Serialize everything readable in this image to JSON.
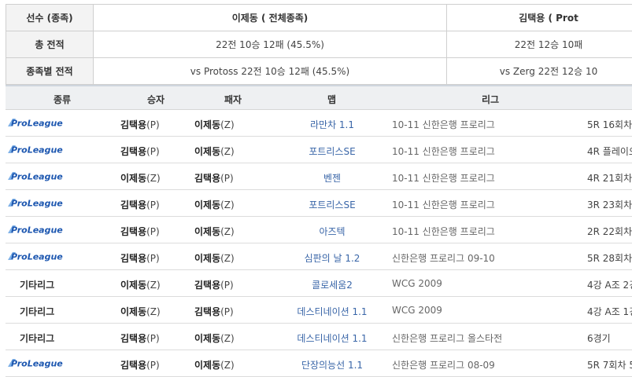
{
  "summary": {
    "header": {
      "label": "선수 (종족)",
      "p1": "이제동 ( 전체종족)",
      "p2": "김택용 ( Prot"
    },
    "total": {
      "label": "총 전적",
      "p1": "22전 10승 12패 (45.5%)",
      "p2": "22전 12승 10패"
    },
    "by_race": {
      "label": "종족별 전적",
      "p1": "vs Protoss 22전 10승 12패 (45.5%)",
      "p2": "vs Zerg 22전 12승 10"
    }
  },
  "columns": {
    "type": "종류",
    "winner": "승자",
    "loser": "패자",
    "map": "맵",
    "league": "리그"
  },
  "proleague_logo_text": "ProLeague",
  "colors": {
    "logo_blue": "#1d57b0",
    "map_link": "#3a66a8",
    "header_bg": "#eef0f2"
  },
  "matches": [
    {
      "type": "proleague",
      "winner": "김택용",
      "winner_race": "(P)",
      "loser": "이제동",
      "loser_race": "(Z)",
      "map": "라만차 1.1",
      "league": "10-11 신한은행 프로리그",
      "round": "5R 16회차"
    },
    {
      "type": "proleague",
      "winner": "김택용",
      "winner_race": "(P)",
      "loser": "이제동",
      "loser_race": "(Z)",
      "map": "포트리스SE",
      "league": "10-11 신한은행 프로리그",
      "round": "4R 플레이오"
    },
    {
      "type": "proleague",
      "winner": "이제동",
      "winner_race": "(Z)",
      "loser": "김택용",
      "loser_race": "(P)",
      "map": "벤젠",
      "league": "10-11 신한은행 프로리그",
      "round": "4R 21회차"
    },
    {
      "type": "proleague",
      "winner": "김택용",
      "winner_race": "(P)",
      "loser": "이제동",
      "loser_race": "(Z)",
      "map": "포트리스SE",
      "league": "10-11 신한은행 프로리그",
      "round": "3R 23회차"
    },
    {
      "type": "proleague",
      "winner": "김택용",
      "winner_race": "(P)",
      "loser": "이제동",
      "loser_race": "(Z)",
      "map": "아즈텍",
      "league": "10-11 신한은행 프로리그",
      "round": "2R 22회차"
    },
    {
      "type": "proleague",
      "winner": "김택용",
      "winner_race": "(P)",
      "loser": "이제동",
      "loser_race": "(Z)",
      "map": "심판의 날 1.2",
      "league": "신한은행 프로리그 09-10",
      "round": "5R 28회차"
    },
    {
      "type": "기타리그",
      "winner": "이제동",
      "winner_race": "(Z)",
      "loser": "김택용",
      "loser_race": "(P)",
      "map": "콜로세움2",
      "league": "WCG 2009",
      "round": "4강 A조 2경"
    },
    {
      "type": "기타리그",
      "winner": "이제동",
      "winner_race": "(Z)",
      "loser": "김택용",
      "loser_race": "(P)",
      "map": "데스티네이션 1.1",
      "league": "WCG 2009",
      "round": "4강 A조 1경"
    },
    {
      "type": "기타리그",
      "winner": "김택용",
      "winner_race": "(P)",
      "loser": "이제동",
      "loser_race": "(Z)",
      "map": "데스티네이션 1.1",
      "league": "신한은행 프로리그 올스타전",
      "round": "6경기"
    },
    {
      "type": "proleague",
      "winner": "김택용",
      "winner_race": "(P)",
      "loser": "이제동",
      "loser_race": "(Z)",
      "map": "단장의능선 1.1",
      "league": "신한은행 프로리그 08-09",
      "round": "5R 7회차 5"
    }
  ]
}
